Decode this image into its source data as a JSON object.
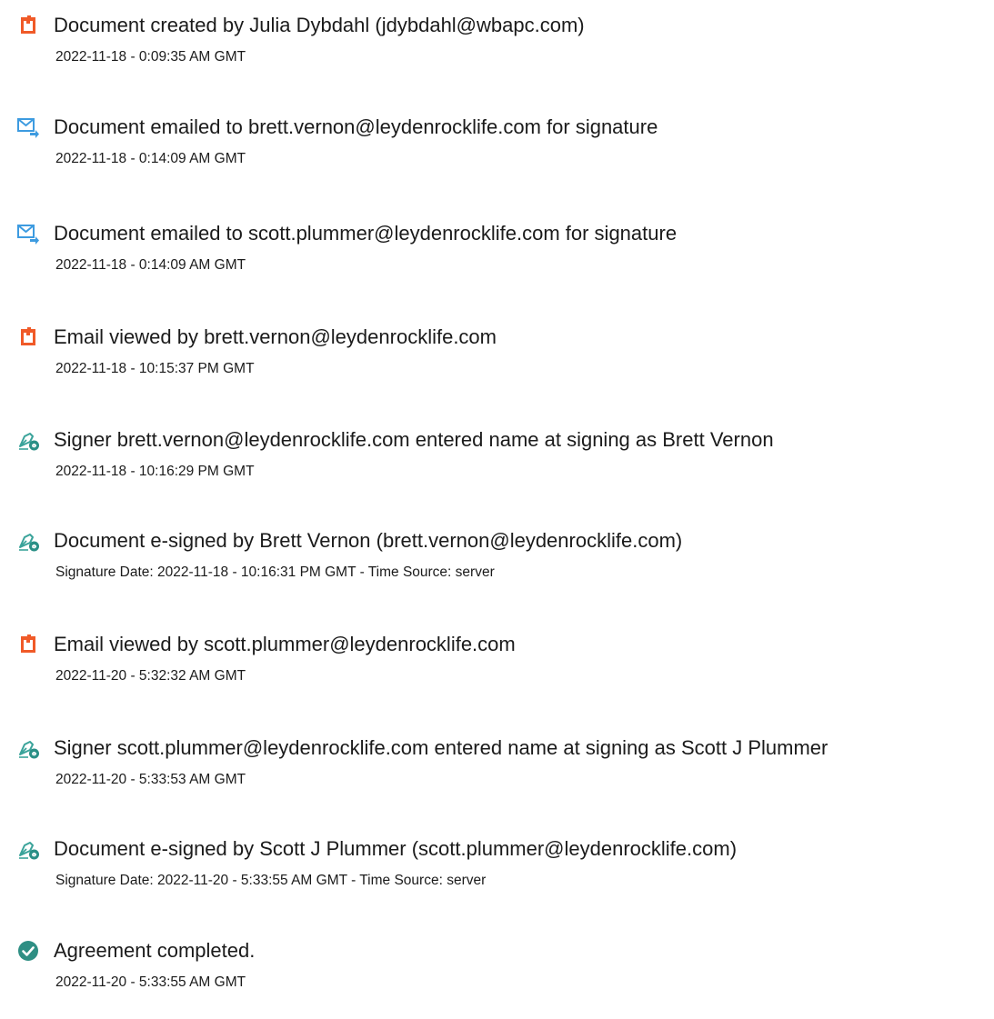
{
  "colors": {
    "created_icon": "#f05a28",
    "email_icon": "#3d9be0",
    "signed_icon_pen": "#3aa39a",
    "signed_icon_badge": "#2a8f86",
    "completed_icon": "#2f8f84"
  },
  "events": [
    {
      "icon": "document-created-icon",
      "title": "Document created by Julia Dybdahl (jdybdahl@wbapc.com)",
      "time": "2022-11-18 - 0:09:35 AM GMT"
    },
    {
      "icon": "email-sent-icon",
      "title": "Document emailed to brett.vernon@leydenrocklife.com for signature",
      "time": "2022-11-18 - 0:14:09 AM GMT"
    },
    {
      "icon": "email-sent-icon",
      "title": "Document emailed to scott.plummer@leydenrocklife.com for signature",
      "time": "2022-11-18 - 0:14:09 AM GMT"
    },
    {
      "icon": "document-viewed-icon",
      "title": "Email viewed by brett.vernon@leydenrocklife.com",
      "time": "2022-11-18 - 10:15:37 PM GMT"
    },
    {
      "icon": "e-sign-pen-icon",
      "title": "Signer brett.vernon@leydenrocklife.com entered name at signing as Brett Vernon",
      "time": "2022-11-18 - 10:16:29 PM GMT"
    },
    {
      "icon": "e-sign-pen-icon",
      "title": "Document e-signed by Brett Vernon (brett.vernon@leydenrocklife.com)",
      "time": "Signature Date: 2022-11-18 - 10:16:31 PM GMT - Time Source: server"
    },
    {
      "icon": "document-viewed-icon",
      "title": "Email viewed by scott.plummer@leydenrocklife.com",
      "time": "2022-11-20 - 5:32:32 AM GMT"
    },
    {
      "icon": "e-sign-pen-icon",
      "title": "Signer scott.plummer@leydenrocklife.com entered name at signing as Scott J Plummer",
      "time": "2022-11-20 - 5:33:53 AM GMT"
    },
    {
      "icon": "e-sign-pen-icon",
      "title": "Document e-signed by Scott J Plummer (scott.plummer@leydenrocklife.com)",
      "time": "Signature Date: 2022-11-20 - 5:33:55 AM GMT - Time Source: server"
    },
    {
      "icon": "check-circle-icon",
      "title": "Agreement completed.",
      "time": "2022-11-20 - 5:33:55 AM GMT"
    }
  ]
}
